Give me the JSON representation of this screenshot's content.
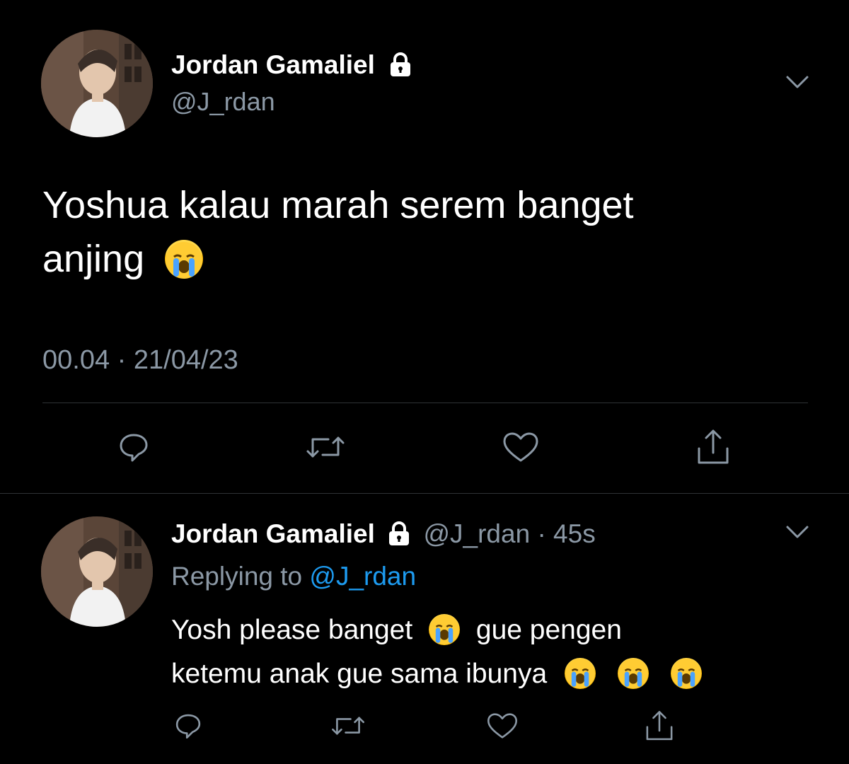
{
  "tweet": {
    "author_name": "Jordan Gamaliel",
    "author_handle": "@J_rdan",
    "text_line1": "Yoshua kalau marah serem banget",
    "text_line2": "anjing",
    "timestamp": "00.04 · 21/04/23",
    "icons": {
      "lock": "lock-icon",
      "menu": "chevron-down-icon",
      "emoji": "loudly-crying-face"
    }
  },
  "actions": [
    "reply-icon",
    "retweet-icon",
    "like-icon",
    "share-icon"
  ],
  "reply": {
    "author_name": "Jordan Gamaliel",
    "author_handle": "@J_rdan",
    "separator": "·",
    "age": "45s",
    "replying_prefix": "Replying to",
    "replying_handle": "@J_rdan",
    "text_line1_a": "Yosh please banget",
    "text_line1_b": "gue pengen",
    "text_line2": "ketemu anak gue sama ibunya"
  },
  "colors": {
    "background": "#000000",
    "text": "#ffffff",
    "muted": "#8b98a5",
    "link": "#1d9bf0",
    "divider": "#2f3336"
  }
}
